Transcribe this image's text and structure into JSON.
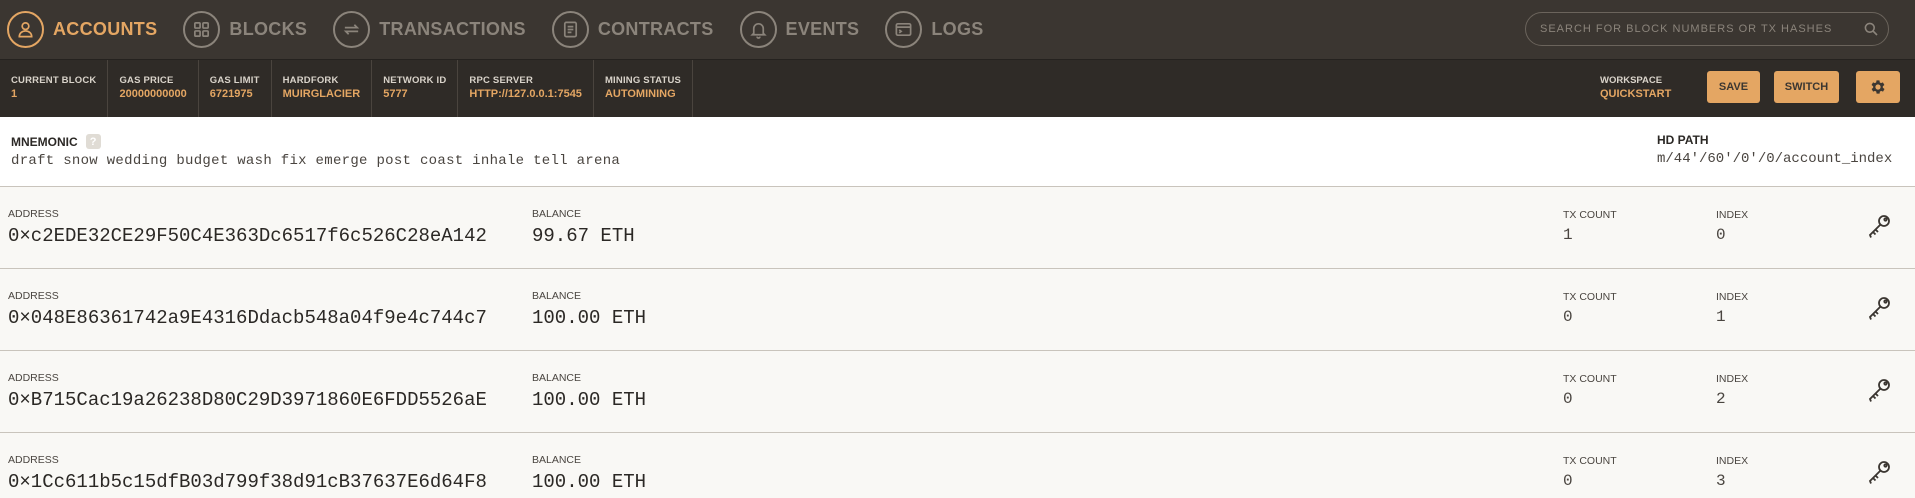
{
  "nav": {
    "items": [
      {
        "label": "ACCOUNTS",
        "icon": "user-icon",
        "active": true
      },
      {
        "label": "BLOCKS",
        "icon": "grid-icon",
        "active": false
      },
      {
        "label": "TRANSACTIONS",
        "icon": "arrows-icon",
        "active": false
      },
      {
        "label": "CONTRACTS",
        "icon": "document-icon",
        "active": false
      },
      {
        "label": "EVENTS",
        "icon": "bell-icon",
        "active": false
      },
      {
        "label": "LOGS",
        "icon": "terminal-icon",
        "active": false
      }
    ],
    "search_placeholder": "SEARCH FOR BLOCK NUMBERS OR TX HASHES"
  },
  "status": {
    "current_block_label": "CURRENT BLOCK",
    "current_block": "1",
    "gas_price_label": "GAS PRICE",
    "gas_price": "20000000000",
    "gas_limit_label": "GAS LIMIT",
    "gas_limit": "6721975",
    "hardfork_label": "HARDFORK",
    "hardfork": "MUIRGLACIER",
    "network_id_label": "NETWORK ID",
    "network_id": "5777",
    "rpc_server_label": "RPC SERVER",
    "rpc_server": "HTTP://127.0.0.1:7545",
    "mining_status_label": "MINING STATUS",
    "mining_status": "AUTOMINING",
    "workspace_label": "WORKSPACE",
    "workspace": "QUICKSTART",
    "save_label": "SAVE",
    "switch_label": "SWITCH"
  },
  "mnemonic": {
    "label": "MNEMONIC",
    "help": "?",
    "words": "draft snow wedding budget wash fix emerge post coast inhale tell arena",
    "hd_path_label": "HD PATH",
    "hd_path": "m/44'/60'/0'/0/account_index"
  },
  "account_labels": {
    "address": "ADDRESS",
    "balance": "BALANCE",
    "tx_count": "TX COUNT",
    "index": "INDEX"
  },
  "accounts": [
    {
      "address": "0×c2EDE32CE29F50C4E363Dc6517f6c526C28eA142",
      "balance": "99.67 ETH",
      "tx_count": "1",
      "index": "0"
    },
    {
      "address": "0×048E86361742a9E4316Ddacb548a04f9e4c744c7",
      "balance": "100.00 ETH",
      "tx_count": "0",
      "index": "1"
    },
    {
      "address": "0×B715Cac19a26238D80C29D3971860E6FDD5526aE",
      "balance": "100.00 ETH",
      "tx_count": "0",
      "index": "2"
    },
    {
      "address": "0×1Cc611b5c15dfB03d799f38d91cB37637E6d64F8",
      "balance": "100.00 ETH",
      "tx_count": "0",
      "index": "3"
    }
  ],
  "colors": {
    "accent": "#e4a663",
    "nav_bg": "#3b3631",
    "status_bg": "#2f2b27"
  }
}
